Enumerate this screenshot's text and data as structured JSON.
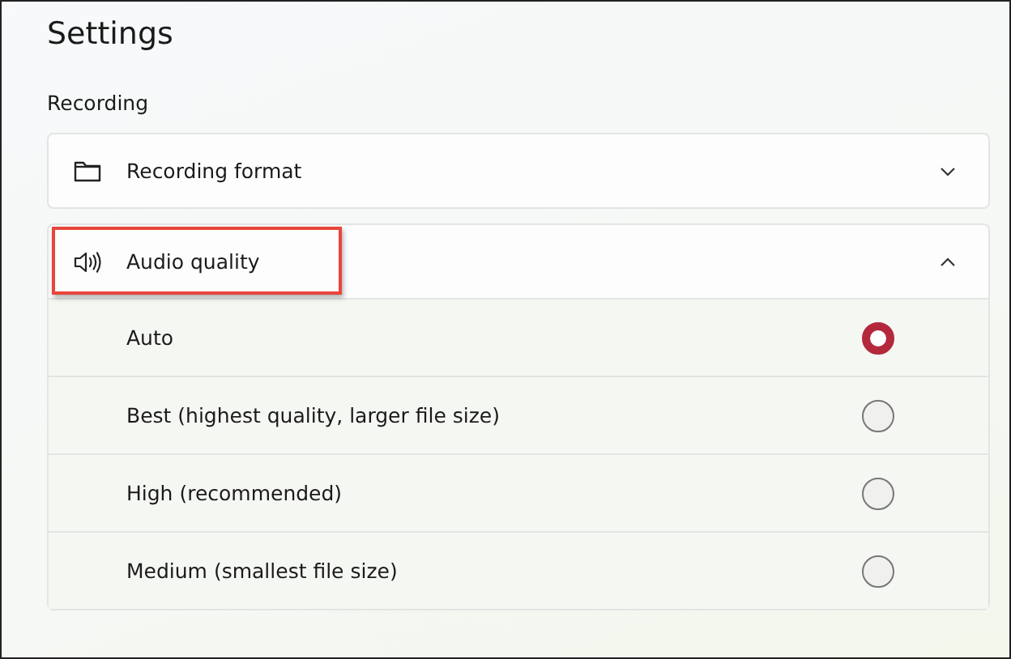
{
  "page_title": "Settings",
  "section_heading": "Recording",
  "expanders": [
    {
      "kind": "folder",
      "label": "Recording format",
      "expanded": false,
      "highlighted": false
    },
    {
      "kind": "speaker",
      "label": "Audio quality",
      "expanded": true,
      "highlighted": true,
      "options": [
        {
          "label": "Auto",
          "selected": true
        },
        {
          "label": "Best (highest quality, larger file size)",
          "selected": false
        },
        {
          "label": "High (recommended)",
          "selected": false
        },
        {
          "label": "Medium (smallest file size)",
          "selected": false
        }
      ]
    }
  ]
}
